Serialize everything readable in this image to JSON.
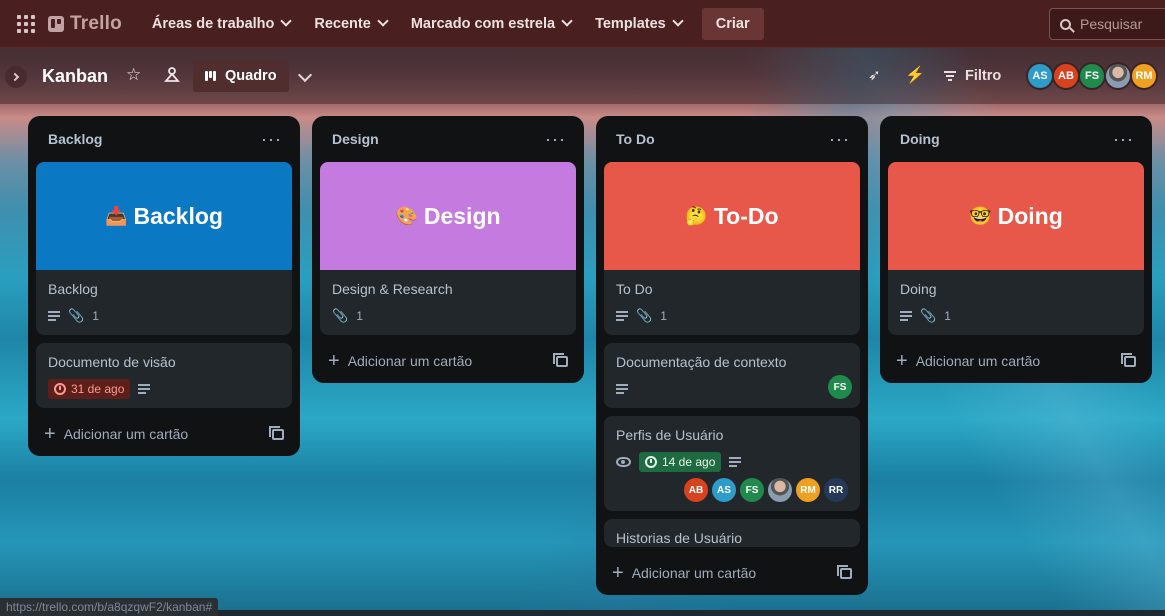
{
  "topbar": {
    "logo": "Trello",
    "menu": [
      "Áreas de trabalho",
      "Recente",
      "Marcado com estrela",
      "Templates"
    ],
    "create_label": "Criar",
    "search_placeholder": "Pesquisar"
  },
  "board": {
    "title": "Kanban",
    "view_label": "Quadro",
    "filter_label": "Filtro",
    "members": [
      {
        "initials": "AS",
        "color": "#2d9cc9"
      },
      {
        "initials": "AB",
        "color": "#d8431f"
      },
      {
        "initials": "FS",
        "color": "#1f8a4c"
      },
      {
        "initials": "",
        "color": "#6b7b8c",
        "photo": true
      },
      {
        "initials": "RM",
        "color": "#f0a020"
      }
    ]
  },
  "lists": [
    {
      "title": "Backlog",
      "cards": [
        {
          "cover_text": "Backlog",
          "cover_icon": "inbox-tray",
          "cover_color": "#0b78c4",
          "title": "Backlog",
          "attachments": "1"
        },
        {
          "title": "Documento de visão",
          "due": "31 de ago",
          "due_status": "overdue"
        }
      ],
      "add_label": "Adicionar um cartão"
    },
    {
      "title": "Design",
      "cards": [
        {
          "cover_text": "Design",
          "cover_icon": "palette",
          "cover_color": "#c47adf",
          "title": "Design & Research",
          "attachments": "1"
        }
      ],
      "add_label": "Adicionar um cartão"
    },
    {
      "title": "To Do",
      "cards": [
        {
          "cover_text": "To-Do",
          "cover_icon": "thinking-face",
          "cover_color": "#e8584a",
          "title": "To Do",
          "attachments": "1"
        },
        {
          "title": "Documentação de contexto",
          "members": [
            "FS"
          ]
        },
        {
          "title": "Perfis de Usuário",
          "due": "14 de ago",
          "due_status": "complete",
          "members": [
            "AB",
            "AS",
            "FS",
            "",
            "RM",
            "RR"
          ]
        },
        {
          "title": "Historias de Usuário"
        }
      ],
      "add_label": "Adicionar um cartão"
    },
    {
      "title": "Doing",
      "cards": [
        {
          "cover_text": "Doing",
          "cover_icon": "nerd-face",
          "cover_color": "#e8584a",
          "title": "Doing",
          "attachments": "1"
        }
      ],
      "add_label": "Adicionar um cartão"
    }
  ],
  "status_url": "https://trello.com/b/a8qzqwF2/kanban#"
}
